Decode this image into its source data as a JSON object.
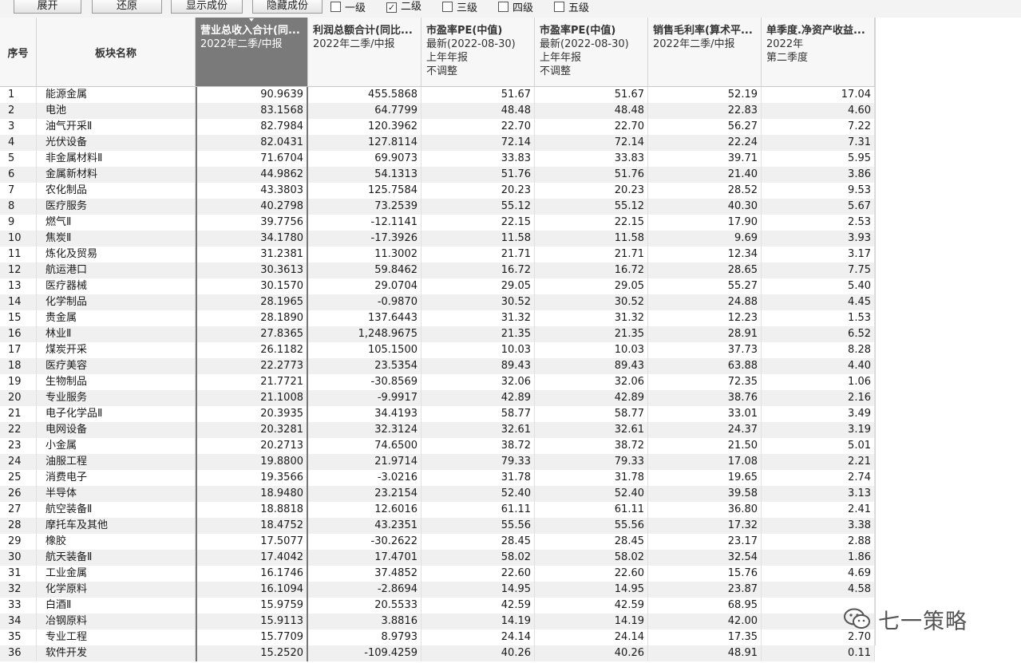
{
  "toolbar": {
    "buttons": [
      "展开",
      "还原",
      "显示成份",
      "隐藏成份"
    ],
    "levels": [
      {
        "label": "一级",
        "checked": false
      },
      {
        "label": "二级",
        "checked": true
      },
      {
        "label": "三级",
        "checked": false
      },
      {
        "label": "四级",
        "checked": false
      },
      {
        "label": "五级",
        "checked": false
      }
    ]
  },
  "columns": {
    "index": "序号",
    "name": "板块名称",
    "c1": {
      "title": "营业总收入合计(同...",
      "sub": [
        "2022年二季/中报"
      ]
    },
    "c2": {
      "title": "利润总额合计(同比...",
      "sub": [
        "2022年二季/中报"
      ]
    },
    "c3": {
      "title": "市盈率PE(中值)",
      "sub": [
        "最新(2022-08-30)",
        "上年年报",
        "不调整"
      ]
    },
    "c4": {
      "title": "市盈率PE(中值)",
      "sub": [
        "最新(2022-08-30)",
        "上年年报",
        "不调整"
      ]
    },
    "c5": {
      "title": "销售毛利率(算术平...",
      "sub": [
        "2022年二季/中报"
      ]
    },
    "c6": {
      "title": "单季度.净资产收益...",
      "sub": [
        "2022年",
        "第二季度"
      ]
    }
  },
  "rows": [
    [
      "1",
      "能源金属",
      "90.9639",
      "455.5868",
      "51.67",
      "51.67",
      "52.19",
      "17.04"
    ],
    [
      "2",
      "电池",
      "83.1568",
      "64.7799",
      "48.48",
      "48.48",
      "22.83",
      "4.60"
    ],
    [
      "3",
      "油气开采Ⅱ",
      "82.7984",
      "120.3962",
      "22.70",
      "22.70",
      "56.27",
      "7.22"
    ],
    [
      "4",
      "光伏设备",
      "82.0431",
      "127.8114",
      "72.14",
      "72.14",
      "22.24",
      "7.31"
    ],
    [
      "5",
      "非金属材料Ⅱ",
      "71.6704",
      "69.9073",
      "33.83",
      "33.83",
      "39.71",
      "5.95"
    ],
    [
      "6",
      "金属新材料",
      "44.9862",
      "54.1313",
      "51.76",
      "51.76",
      "21.40",
      "3.86"
    ],
    [
      "7",
      "农化制品",
      "43.3803",
      "125.7584",
      "20.23",
      "20.23",
      "28.52",
      "9.53"
    ],
    [
      "8",
      "医疗服务",
      "40.2798",
      "73.2539",
      "55.12",
      "55.12",
      "40.30",
      "5.67"
    ],
    [
      "9",
      "燃气Ⅱ",
      "39.7756",
      "-12.1141",
      "22.15",
      "22.15",
      "17.90",
      "2.53"
    ],
    [
      "10",
      "焦炭Ⅱ",
      "34.1780",
      "-17.3926",
      "11.58",
      "11.58",
      "9.69",
      "3.93"
    ],
    [
      "11",
      "炼化及贸易",
      "31.2381",
      "11.3002",
      "21.71",
      "21.71",
      "12.34",
      "3.17"
    ],
    [
      "12",
      "航运港口",
      "30.3613",
      "59.8462",
      "16.72",
      "16.72",
      "28.65",
      "7.75"
    ],
    [
      "13",
      "医疗器械",
      "30.1570",
      "29.0704",
      "29.05",
      "29.05",
      "55.27",
      "5.40"
    ],
    [
      "14",
      "化学制品",
      "28.1965",
      "-0.9870",
      "30.52",
      "30.52",
      "24.88",
      "4.45"
    ],
    [
      "15",
      "贵金属",
      "28.1890",
      "137.6443",
      "31.32",
      "31.32",
      "12.23",
      "1.53"
    ],
    [
      "16",
      "林业Ⅱ",
      "27.8365",
      "1,248.9675",
      "21.35",
      "21.35",
      "28.91",
      "6.52"
    ],
    [
      "17",
      "煤炭开采",
      "26.1182",
      "105.1500",
      "10.03",
      "10.03",
      "37.73",
      "8.28"
    ],
    [
      "18",
      "医疗美容",
      "22.2773",
      "23.5354",
      "89.43",
      "89.43",
      "63.88",
      "4.40"
    ],
    [
      "19",
      "生物制品",
      "21.7721",
      "-30.8569",
      "32.06",
      "32.06",
      "72.35",
      "1.06"
    ],
    [
      "20",
      "专业服务",
      "21.1008",
      "-9.9917",
      "42.89",
      "42.89",
      "38.76",
      "2.16"
    ],
    [
      "21",
      "电子化学品Ⅱ",
      "20.3935",
      "34.4193",
      "58.77",
      "58.77",
      "33.01",
      "3.49"
    ],
    [
      "22",
      "电网设备",
      "20.3281",
      "32.3124",
      "32.61",
      "32.61",
      "24.37",
      "3.19"
    ],
    [
      "23",
      "小金属",
      "20.2713",
      "74.6500",
      "38.72",
      "38.72",
      "21.50",
      "5.01"
    ],
    [
      "24",
      "油服工程",
      "19.8800",
      "21.9714",
      "79.33",
      "79.33",
      "17.08",
      "2.21"
    ],
    [
      "25",
      "消费电子",
      "19.3566",
      "-3.0216",
      "31.78",
      "31.78",
      "19.65",
      "2.74"
    ],
    [
      "26",
      "半导体",
      "18.9480",
      "23.2154",
      "52.40",
      "52.40",
      "39.58",
      "3.13"
    ],
    [
      "27",
      "航空装备Ⅱ",
      "18.8818",
      "12.6016",
      "61.11",
      "61.11",
      "36.80",
      "2.41"
    ],
    [
      "28",
      "摩托车及其他",
      "18.4752",
      "43.2351",
      "55.56",
      "55.56",
      "17.32",
      "3.38"
    ],
    [
      "29",
      "橡胶",
      "17.5077",
      "-30.2622",
      "28.45",
      "28.45",
      "23.17",
      "2.88"
    ],
    [
      "30",
      "航天装备Ⅱ",
      "17.4042",
      "17.4701",
      "58.02",
      "58.02",
      "32.54",
      "1.86"
    ],
    [
      "31",
      "工业金属",
      "16.1746",
      "37.4852",
      "22.60",
      "22.60",
      "15.76",
      "4.69"
    ],
    [
      "32",
      "化学原料",
      "16.1094",
      "-2.8694",
      "14.95",
      "14.95",
      "23.87",
      "4.58"
    ],
    [
      "33",
      "白酒Ⅱ",
      "15.9759",
      "20.5533",
      "42.59",
      "42.59",
      "68.95",
      ""
    ],
    [
      "34",
      "冶钢原料",
      "15.9113",
      "3.8816",
      "14.19",
      "14.19",
      "42.00",
      ""
    ],
    [
      "35",
      "专业工程",
      "15.7709",
      "8.9793",
      "24.14",
      "24.14",
      "17.35",
      "2.70"
    ],
    [
      "36",
      "软件开发",
      "15.2520",
      "-109.4259",
      "40.26",
      "40.26",
      "48.91",
      "0.11"
    ]
  ],
  "watermark": {
    "text": "七一策略"
  }
}
